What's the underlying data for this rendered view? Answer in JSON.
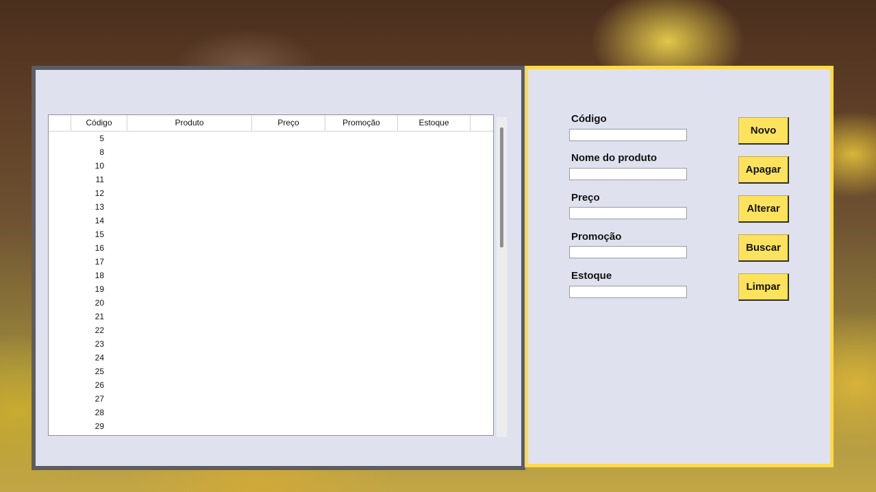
{
  "table": {
    "columns": [
      "",
      "Código",
      "Produto",
      "Preço",
      "Promoção",
      "Estoque"
    ],
    "rows": [
      "5",
      "8",
      "10",
      "11",
      "12",
      "13",
      "14",
      "15",
      "16",
      "17",
      "18",
      "19",
      "20",
      "21",
      "22",
      "23",
      "24",
      "25",
      "26",
      "27",
      "28",
      "29"
    ]
  },
  "form": {
    "fields": [
      {
        "label": "Código",
        "value": ""
      },
      {
        "label": "Nome do produto",
        "value": ""
      },
      {
        "label": "Preço",
        "value": ""
      },
      {
        "label": "Promoção",
        "value": ""
      },
      {
        "label": "Estoque",
        "value": ""
      }
    ]
  },
  "buttons": [
    "Novo",
    "Apagar",
    "Alterar",
    "Buscar",
    "Limpar"
  ],
  "colors": {
    "left_panel_border": "#5b5d63",
    "right_panel_border": "#fcd94d",
    "panel_background": "#dfe1ee",
    "button_background": "#fde35d"
  }
}
